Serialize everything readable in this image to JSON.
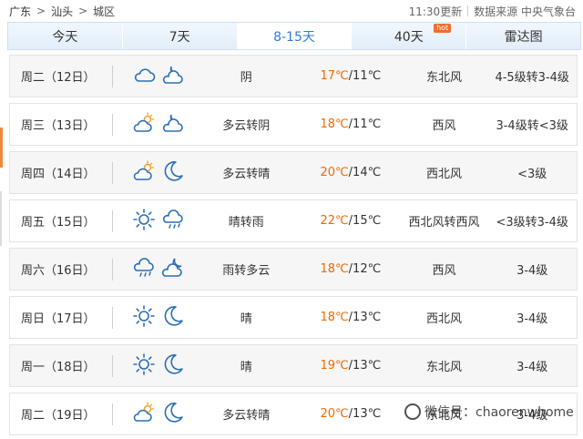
{
  "breadcrumb": {
    "province": "广东",
    "city": "汕头",
    "district": "城区",
    "separator": ">"
  },
  "header": {
    "update_time": "11:30更新",
    "source": "数据来源 中央气象台"
  },
  "tabs": [
    {
      "label": "今天",
      "active": false
    },
    {
      "label": "7天",
      "active": false
    },
    {
      "label": "8-15天",
      "active": true
    },
    {
      "label": "40天",
      "active": false,
      "badge": "hot"
    },
    {
      "label": "雷达图",
      "active": false
    }
  ],
  "colors": {
    "accent": "#2f7bd1",
    "temp_high": "#f06a00",
    "tab_bg": "#e3eef9"
  },
  "forecast": [
    {
      "day": "周二（12日）",
      "icon_day": "cloudy-icon",
      "icon_night": "overcast-night-icon",
      "desc": "阴",
      "high": "17℃",
      "low": "/11℃",
      "wind": "东北风",
      "level": "4-5级转3-4级"
    },
    {
      "day": "周三（13日）",
      "icon_day": "partly-cloudy-icon",
      "icon_night": "overcast-night-icon",
      "desc": "多云转阴",
      "high": "18℃",
      "low": "/11℃",
      "wind": "西风",
      "level": "3-4级转<3级"
    },
    {
      "day": "周四（14日）",
      "icon_day": "partly-cloudy-icon",
      "icon_night": "moon-icon",
      "desc": "多云转晴",
      "high": "20℃",
      "low": "/14℃",
      "wind": "西北风",
      "level": "<3级"
    },
    {
      "day": "周五（15日）",
      "icon_day": "sun-icon",
      "icon_night": "rain-icon",
      "desc": "晴转雨",
      "high": "22℃",
      "low": "/15℃",
      "wind": "西北风转西风",
      "level": "<3级转3-4级"
    },
    {
      "day": "周六（16日）",
      "icon_day": "rain-icon",
      "icon_night": "cloudy-night-icon",
      "desc": "雨转多云",
      "high": "18℃",
      "low": "/12℃",
      "wind": "西风",
      "level": "3-4级"
    },
    {
      "day": "周日（17日）",
      "icon_day": "sun-icon",
      "icon_night": "moon-icon",
      "desc": "晴",
      "high": "18℃",
      "low": "/13℃",
      "wind": "西北风",
      "level": "3-4级"
    },
    {
      "day": "周一（18日）",
      "icon_day": "sun-icon",
      "icon_night": "moon-icon",
      "desc": "晴",
      "high": "19℃",
      "low": "/13℃",
      "wind": "东北风",
      "level": "3-4级"
    },
    {
      "day": "周二（19日）",
      "icon_day": "partly-cloudy-icon",
      "icon_night": "moon-icon",
      "desc": "多云转晴",
      "high": "20℃",
      "low": "/13℃",
      "wind": "东北风",
      "level": "3-4级"
    }
  ],
  "watermark": "微信号：chaorenwhome"
}
